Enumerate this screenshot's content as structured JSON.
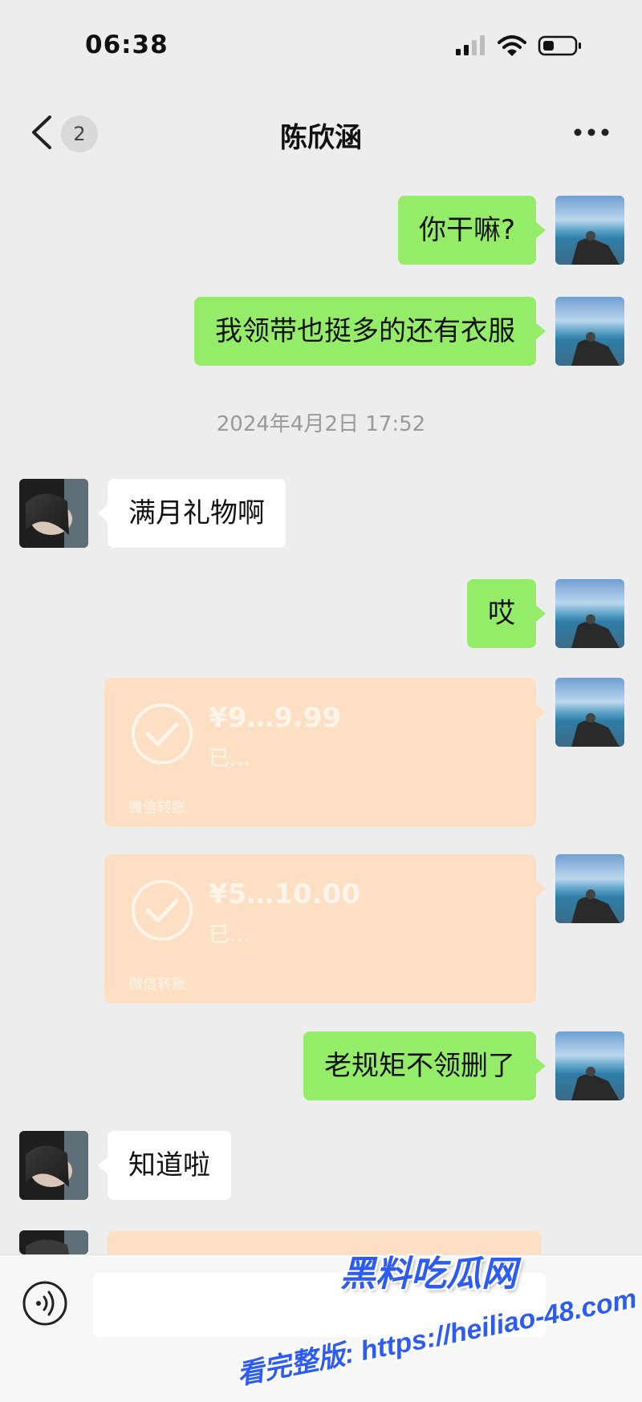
{
  "status_bar": {
    "time": "06:38",
    "icons": [
      "signal-icon",
      "wifi-icon",
      "battery-icon"
    ]
  },
  "nav": {
    "unread_count": "2",
    "title": "陈欣涵",
    "back_icon": "chevron-left-icon",
    "more_icon": "more-icon"
  },
  "messages": [
    {
      "side": "right",
      "text": "你干嘛?"
    },
    {
      "side": "right",
      "text": "我领带也挺多的还有衣服"
    },
    {
      "side": "left",
      "text": "满月礼物啊"
    },
    {
      "side": "right",
      "text": "哎"
    },
    {
      "side": "right",
      "text": "老规矩不领删了"
    },
    {
      "side": "left",
      "text": "知道啦"
    }
  ],
  "timestamp": "2024年4月2日 17:52",
  "transfers": [
    {
      "amount": "¥9…9.99",
      "status": "已…",
      "footer": "微信转账"
    },
    {
      "amount": "¥5…10.00",
      "status": "已…",
      "footer": "微信转账"
    }
  ],
  "input_bar": {
    "voice_icon": "voice-icon",
    "input_value": ""
  },
  "watermark": {
    "brand": "黑料吃瓜网",
    "url_line": "看完整版: https://heiliao-48.com"
  },
  "colors": {
    "background": "#ededed",
    "sent_bubble": "#95ec69",
    "received_bubble": "#ffffff",
    "transfer_card": "#fde0c3",
    "watermark_blue": "#2d5cf5"
  }
}
